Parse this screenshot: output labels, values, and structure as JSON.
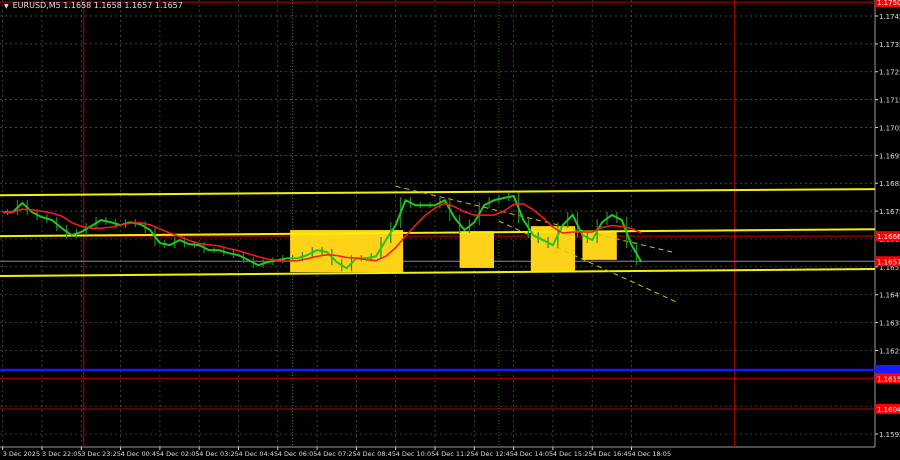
{
  "header": {
    "symbol_line": "EURUSD,M5  1.1658 1.1658 1.1657 1.1657",
    "menu_icon": "triangle-down-icon"
  },
  "colors": {
    "background": "#000000",
    "grid": "#5a5a5a",
    "price": "#22c722",
    "ma": "#ff1a1a",
    "level": "#f2f200",
    "zone": "#ffd21a",
    "red_line": "#c00000",
    "blue_line": "#1a1aff",
    "label_red": "#ff0000",
    "axis_text": "#dcdcdc"
  },
  "chart_data": {
    "type": "line",
    "title": "EURUSD,M5",
    "ylim": [
      1.1593,
      1.1751
    ],
    "grid": true,
    "y_ticks": [
      "1.1745",
      "1.1735",
      "1.1725",
      "1.1715",
      "1.1705",
      "1.1695",
      "1.1685",
      "1.1675",
      "1.1665",
      "1.1655",
      "1.1645",
      "1.1635",
      "1.1625",
      "1.1615",
      "1.1605",
      "1.1595"
    ],
    "x_ticks": [
      "3 Dec 2025",
      "3 Dec 22:05",
      "3 Dec 23:25",
      "4 Dec 00:45",
      "4 Dec 02:05",
      "4 Dec 03:25",
      "4 Dec 04:45",
      "4 Dec 06:05",
      "4 Dec 07:25",
      "4 Dec 08:45",
      "4 Dec 10:05",
      "4 Dec 11:25",
      "4 Dec 12:45",
      "4 Dec 14:05",
      "4 Dec 15:25",
      "4 Dec 16:45",
      "4 Dec 18:05"
    ],
    "series": [
      {
        "x": [
          "3 Dec 20:45",
          "3 Dec 21:05",
          "3 Dec 21:25",
          "3 Dec 21:45",
          "3 Dec 22:05",
          "3 Dec 22:25",
          "3 Dec 22:45",
          "3 Dec 23:05",
          "3 Dec 23:25",
          "3 Dec 23:45",
          "4 Dec 00:05",
          "4 Dec 00:25",
          "4 Dec 00:45",
          "4 Dec 01:05",
          "4 Dec 01:25",
          "4 Dec 01:45",
          "4 Dec 02:05",
          "4 Dec 02:25",
          "4 Dec 02:45",
          "4 Dec 03:05",
          "4 Dec 03:25",
          "4 Dec 03:45",
          "4 Dec 04:05",
          "4 Dec 04:25",
          "4 Dec 04:45",
          "4 Dec 05:05",
          "4 Dec 05:25",
          "4 Dec 05:45",
          "4 Dec 06:05",
          "4 Dec 06:25",
          "4 Dec 06:45",
          "4 Dec 07:05",
          "4 Dec 07:25",
          "4 Dec 07:45",
          "4 Dec 08:05",
          "4 Dec 08:25",
          "4 Dec 08:45",
          "4 Dec 09:05",
          "4 Dec 09:25",
          "4 Dec 09:45",
          "4 Dec 10:05",
          "4 Dec 10:25",
          "4 Dec 10:45",
          "4 Dec 11:05",
          "4 Dec 11:25",
          "4 Dec 11:45",
          "4 Dec 12:05",
          "4 Dec 12:25",
          "4 Dec 12:45",
          "4 Dec 13:05",
          "4 Dec 13:25",
          "4 Dec 13:45",
          "4 Dec 14:05",
          "4 Dec 14:25",
          "4 Dec 14:45",
          "4 Dec 15:05",
          "4 Dec 15:25",
          "4 Dec 15:45",
          "4 Dec 16:05",
          "4 Dec 16:25",
          "4 Dec 16:45",
          "4 Dec 17:05",
          "4 Dec 17:25",
          "4 Dec 17:45",
          "4 Dec 18:05",
          "4 Dec 18:25"
        ],
        "y": [
          1.16746,
          1.16746,
          1.16779,
          1.16746,
          1.16728,
          1.16718,
          1.16689,
          1.16664,
          1.16675,
          1.16696,
          1.16718,
          1.1671,
          1.167,
          1.1671,
          1.16703,
          1.16682,
          1.16635,
          1.16628,
          1.16646,
          1.16631,
          1.16628,
          1.1661,
          1.1661,
          1.16599,
          1.16592,
          1.16574,
          1.16556,
          1.16567,
          1.16574,
          1.16581,
          1.16581,
          1.16592,
          1.1661,
          1.16603,
          1.16567,
          1.16545,
          1.16581,
          1.16581,
          1.16588,
          1.16646,
          1.167,
          1.16789,
          1.16771,
          1.16771,
          1.16771,
          1.16789,
          1.16725,
          1.16682,
          1.1671,
          1.16771,
          1.16789,
          1.16797,
          1.16804,
          1.16718,
          1.16664,
          1.16646,
          1.16628,
          1.167,
          1.16736,
          1.16664,
          1.16646,
          1.1671,
          1.16736,
          1.16718,
          1.16628,
          1.16567
        ]
      }
    ],
    "levels": [
      {
        "from": 1.16807,
        "to": 1.16829
      },
      {
        "from": 1.1666,
        "to": 1.16685
      },
      {
        "from": 1.16517,
        "to": 1.16542
      }
    ],
    "trendlines": [
      {
        "start": [
          "4 Dec 10:05",
          1.16839
        ],
        "end": [
          "4 Dec 19:35",
          1.166
        ]
      },
      {
        "start": [
          "4 Dec 13:35",
          1.16714
        ],
        "end": [
          "4 Dec 19:35",
          1.16425
        ]
      }
    ],
    "zones": [
      {
        "from": "4 Dec 06:30",
        "to": "4 Dec 10:20",
        "high": 1.16682,
        "low": 1.16531
      },
      {
        "from": "4 Dec 12:15",
        "to": "4 Dec 13:25",
        "high": 1.16678,
        "low": 1.16546
      },
      {
        "from": "4 Dec 14:40",
        "to": "4 Dec 16:10",
        "high": 1.16696,
        "low": 1.16535
      },
      {
        "from": "4 Dec 16:25",
        "to": "4 Dec 17:35",
        "high": 1.16675,
        "low": 1.16575
      }
    ],
    "horizontal_lines": [
      {
        "price": 1.175,
        "label": "1.1750",
        "color": "red"
      },
      {
        "price": 1.1666,
        "label": "1.1666",
        "color": "red"
      },
      {
        "price": 1.1657,
        "label": "1.1657",
        "color": "grey"
      },
      {
        "price": 1.1618,
        "label": "",
        "color": "blue"
      },
      {
        "price": 1.1615,
        "label": "1.1615",
        "color": "red"
      },
      {
        "price": 1.1604,
        "label": "1.1604",
        "color": "red"
      }
    ],
    "vertical_lines": [
      {
        "time": "3 Dec 23:30",
        "color": "red"
      },
      {
        "time": "4 Dec 06:35",
        "color": "green-dotted"
      },
      {
        "time": "4 Dec 13:35",
        "color": "green-dotted"
      },
      {
        "time": "4 Dec 21:35",
        "color": "red"
      }
    ]
  }
}
